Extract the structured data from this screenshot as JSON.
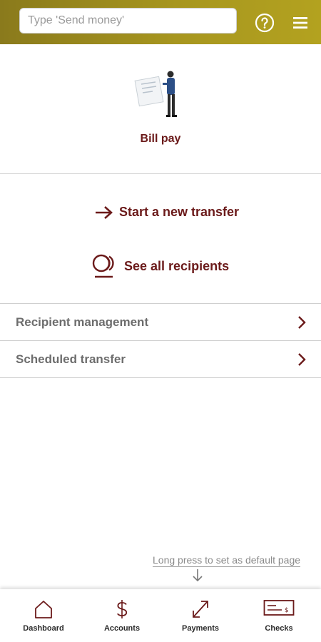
{
  "header": {
    "search_placeholder": "Type 'Send money'"
  },
  "billpay": {
    "label": "Bill pay"
  },
  "actions": {
    "new_transfer": "Start a new transfer",
    "see_recipients": "See all recipients"
  },
  "list": {
    "items": [
      {
        "label": "Recipient management"
      },
      {
        "label": "Scheduled transfer"
      }
    ]
  },
  "hint": {
    "text": "Long press to set as default page"
  },
  "tabs": [
    {
      "label": "Dashboard",
      "icon": "home-icon"
    },
    {
      "label": "Accounts",
      "icon": "dollar-icon"
    },
    {
      "label": "Payments",
      "icon": "transfer-arrows-icon",
      "active": true
    },
    {
      "label": "Checks",
      "icon": "check-icon"
    }
  ],
  "colors": {
    "brand_gold": "#a7961f",
    "accent_maroon": "#6b1a1a",
    "active_tab_bubble": "#e88d8d"
  }
}
